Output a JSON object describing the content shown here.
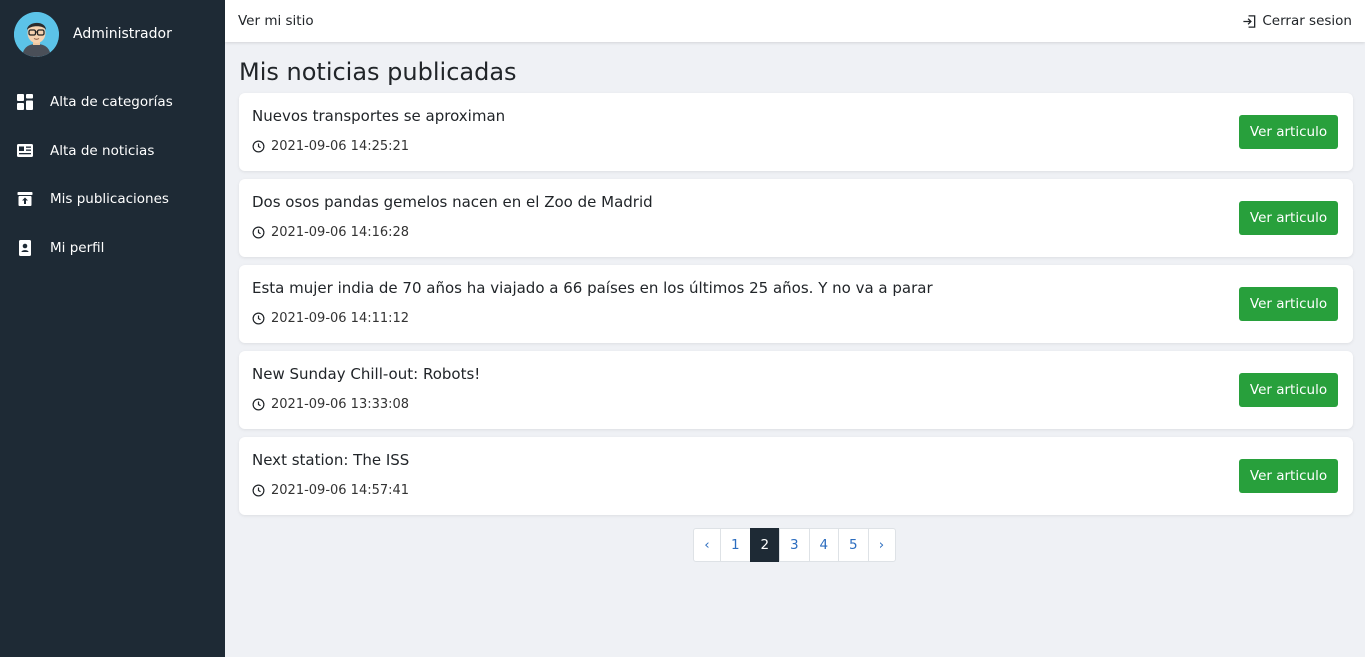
{
  "sidebar": {
    "user": "Administrador",
    "items": [
      {
        "label": "Alta de categorías",
        "icon": "dashboard-icon"
      },
      {
        "label": "Alta de noticias",
        "icon": "newspaper-icon"
      },
      {
        "label": "Mis publicaciones",
        "icon": "archive-upload-icon"
      },
      {
        "label": "Mi perfil",
        "icon": "contact-card-icon"
      }
    ]
  },
  "topbar": {
    "site_link": "Ver mi sitio",
    "logout": "Cerrar sesion"
  },
  "main": {
    "title": "Mis noticias publicadas",
    "button_label": "Ver articulo",
    "articles": [
      {
        "title": "Nuevos transportes se aproximan",
        "date": "2021-09-06 14:25:21"
      },
      {
        "title": "Dos osos pandas gemelos nacen en el Zoo de Madrid",
        "date": "2021-09-06 14:16:28"
      },
      {
        "title": "Esta mujer india de 70 años ha viajado a 66 países en los últimos 25 años. Y no va a parar",
        "date": "2021-09-06 14:11:12"
      },
      {
        "title": "New Sunday Chill-out: Robots!",
        "date": "2021-09-06 13:33:08"
      },
      {
        "title": "Next station: The ISS",
        "date": "2021-09-06 14:57:41"
      }
    ]
  },
  "pagination": {
    "prev": "‹",
    "next": "›",
    "pages": [
      "1",
      "2",
      "3",
      "4",
      "5"
    ],
    "current": "2"
  },
  "colors": {
    "sidebar_bg": "#1e2a35",
    "button_green": "#28a03c",
    "link_blue": "#2c6dbf"
  }
}
